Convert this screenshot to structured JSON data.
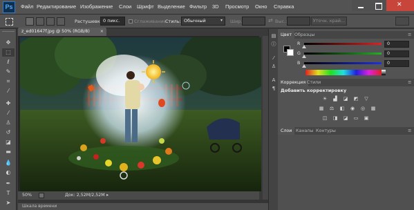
{
  "app": {
    "logo": "Ps"
  },
  "menu": [
    {
      "label": "Файл"
    },
    {
      "label": "Редактирование"
    },
    {
      "label": "Изображение"
    },
    {
      "label": "Слои"
    },
    {
      "label": "Шрифт"
    },
    {
      "label": "Выделение"
    },
    {
      "label": "Фильтр"
    },
    {
      "label": "3D"
    },
    {
      "label": "Просмотр"
    },
    {
      "label": "Окно"
    },
    {
      "label": "Справка"
    }
  ],
  "options": {
    "feather_label": "Растушевка:",
    "feather_value": "0 пикс.",
    "antialias_label": "Сглаживание",
    "style_label": "Стиль:",
    "style_value": "Обычный",
    "width_label": "Шир.:",
    "height_label": "Выс.:",
    "refine_edge": "Уточн. край..."
  },
  "document": {
    "tab_title": "z_ed01647f.jpg @ 50% (RGB/8)",
    "zoom": "50%",
    "doc_size": "Док: 2,52M/2,52M"
  },
  "timeline": {
    "label": "Шкала времени"
  },
  "color_panel": {
    "tabs": [
      "Цвет",
      "Образцы"
    ],
    "channels": [
      {
        "label": "R",
        "value": "0",
        "color": "#e22020"
      },
      {
        "label": "G",
        "value": "0",
        "color": "#22b022"
      },
      {
        "label": "B",
        "value": "0",
        "color": "#2030e0"
      }
    ]
  },
  "adjustments_panel": {
    "tabs": [
      "Коррекция",
      "Стили"
    ],
    "title": "Добавить корректировку"
  },
  "layers_panel": {
    "tabs": [
      "Слои",
      "Каналы",
      "Контуры"
    ]
  },
  "colors": {
    "foreground": "#000000",
    "background": "#ffffff",
    "accent_close": "#c7453a"
  }
}
